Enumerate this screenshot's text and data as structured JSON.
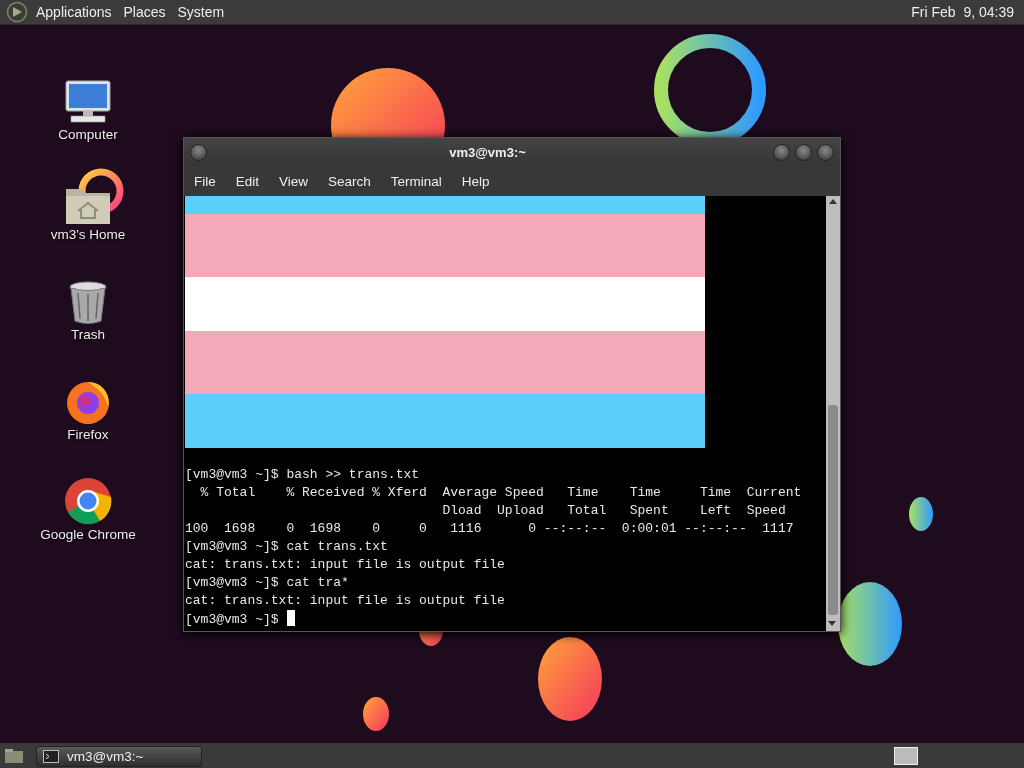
{
  "top_panel": {
    "menus": [
      "Applications",
      "Places",
      "System"
    ],
    "clock": "Fri Feb  9, 04:39"
  },
  "desktop_icons": [
    {
      "label": "Computer",
      "kind": "computer"
    },
    {
      "label": "vm3's Home",
      "kind": "home"
    },
    {
      "label": "Trash",
      "kind": "trash"
    },
    {
      "label": "Firefox",
      "kind": "firefox"
    },
    {
      "label": "Google Chrome",
      "kind": "chrome"
    }
  ],
  "terminal": {
    "title": "vm3@vm3:~",
    "menus": [
      "File",
      "Edit",
      "View",
      "Search",
      "Terminal",
      "Help"
    ],
    "lines": [
      "[vm3@vm3 ~]$ bash >> trans.txt",
      "  % Total    % Received % Xferd  Average Speed   Time    Time     Time  Current",
      "                                 Dload  Upload   Total   Spent    Left  Speed",
      "100  1698    0  1698    0     0   1116      0 --:--:--  0:00:01 --:--:--  1117",
      "[vm3@vm3 ~]$ cat trans.txt",
      "cat: trans.txt: input file is output file",
      "[vm3@vm3 ~]$ cat tra*",
      "cat: trans.txt: input file is output file"
    ],
    "prompt": "[vm3@vm3 ~]$"
  },
  "taskbar": {
    "tasks": [
      {
        "label": "vm3@vm3:~",
        "selected": true
      }
    ]
  }
}
